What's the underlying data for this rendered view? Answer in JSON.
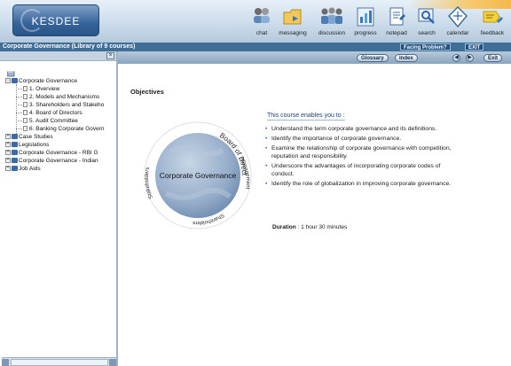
{
  "header": {
    "logo_text": "KESDEE",
    "tools": [
      {
        "id": "chat",
        "label": "chat"
      },
      {
        "id": "messaging",
        "label": "messaging"
      },
      {
        "id": "discussion",
        "label": "discussion"
      },
      {
        "id": "progress",
        "label": "progress"
      },
      {
        "id": "notepad",
        "label": "notepad"
      },
      {
        "id": "search",
        "label": "search"
      },
      {
        "id": "calendar",
        "label": "calendar"
      },
      {
        "id": "feedback",
        "label": "feedback"
      }
    ]
  },
  "titlebar": {
    "course_title": "Corporate Governance (Library of 9 courses)",
    "facing_problem_label": "Facing Problem?",
    "exit_label": "EXIT"
  },
  "nav": {
    "glossary_label": "Glossary",
    "index_label": "Index",
    "exit_label": "Exit"
  },
  "tree": {
    "root": "Corporate Governance",
    "children": [
      "1. Overview",
      "2. Models and Mechanisms",
      "3. Shareholders and Stakeho",
      "4. Board of Directors",
      "5. Audit Committee",
      "6. Banking Corporate Govern"
    ],
    "siblings": [
      "Case Studies",
      "Legislations",
      "Corporate Governance - RBI G",
      "Corporate Governance - Indian",
      "Job Aids"
    ]
  },
  "content": {
    "heading": "Objectives",
    "intro": "This course enables you to :",
    "objectives": [
      "Understand the term corporate governance and its definitions.",
      "Identify the importance of corporate governance.",
      "Examine the relationship of corporate governance with competition, reputation and responsibility.",
      "Underscore the advantages of incorporating corporate codes of conduct.",
      "Identify the role of globalization in improving corporate governance."
    ],
    "duration_label": "Duration",
    "duration_value": ": 1 hour 30 minutes"
  },
  "globe": {
    "center_label": "Corporate Governance",
    "ring_labels": [
      "Board of Directors",
      "Management",
      "Shareholders",
      "Stakeholders"
    ]
  },
  "colors": {
    "titlebar": "#3f6e98",
    "link_blue": "#1d3f7a",
    "header_top": "#e6f0f8"
  }
}
